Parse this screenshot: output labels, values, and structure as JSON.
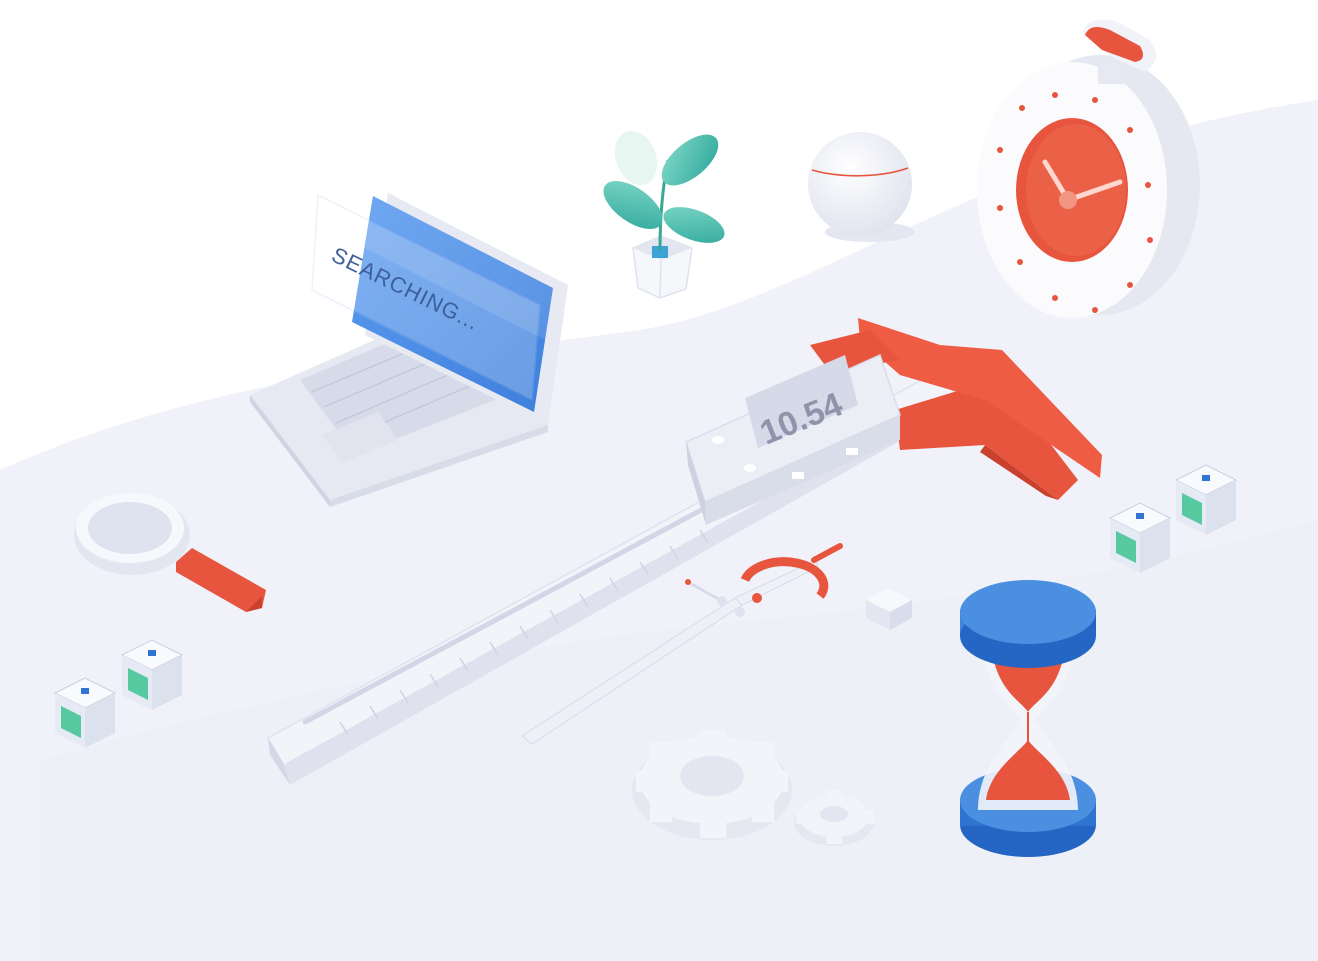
{
  "laptop": {
    "screen_text": "SEARCHING..."
  },
  "caliper": {
    "readout": "10.54"
  },
  "colors": {
    "accent_red": "#e8553e",
    "accent_blue": "#4b8fe0",
    "leaf_teal": "#4fc1b6",
    "cube_green": "#56c9a0",
    "floor": "#eef0f8",
    "surface": "#f4f5fb"
  },
  "icons": [
    "laptop-icon",
    "plant-icon",
    "sphere-icon",
    "stopwatch-icon",
    "caliper-icon",
    "magnifier-icon",
    "compass-icon",
    "gear-icon",
    "hourglass-icon",
    "chip-cube-icon"
  ]
}
